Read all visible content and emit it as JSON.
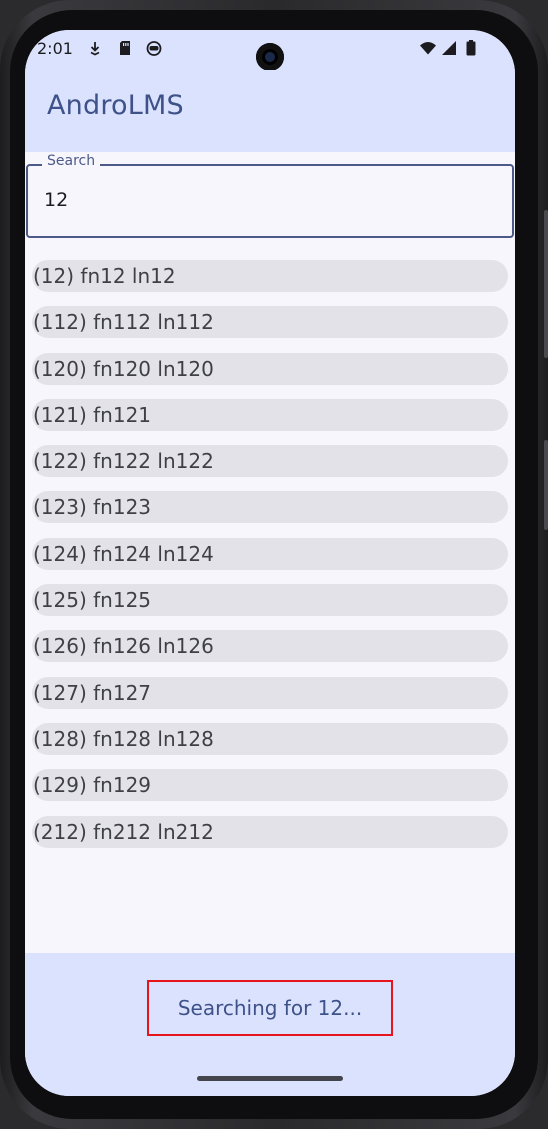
{
  "status_bar": {
    "time": "2:01",
    "left_icons": [
      "download-icon",
      "sd-card-icon",
      "android-face-icon"
    ],
    "right_icons": [
      "wifi-icon",
      "cell-signal-icon",
      "battery-icon"
    ]
  },
  "app_bar": {
    "title": "AndroLMS"
  },
  "search": {
    "label": "Search",
    "value": "12"
  },
  "results": [
    "(12) fn12 ln12",
    "(112) fn112 ln112",
    "(120) fn120 ln120",
    "(121) fn121",
    "(122) fn122 ln122",
    "(123) fn123",
    "(124) fn124 ln124",
    "(125) fn125",
    "(126) fn126 ln126",
    "(127) fn127",
    "(128) fn128 ln128",
    "(129) fn129",
    "(212) fn212 ln212"
  ],
  "bottom_bar": {
    "status_message": "Searching for 12..."
  },
  "colors": {
    "app_bar_bg": "#dbe2fd",
    "title": "#3e5289",
    "item_bg": "#e3e2e9",
    "highlight_border": "#e8141b"
  }
}
